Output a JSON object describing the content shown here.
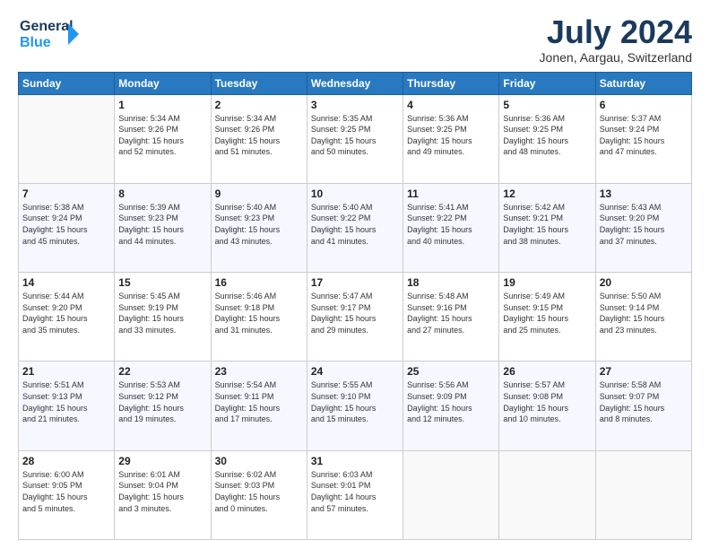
{
  "header": {
    "logo_line1": "General",
    "logo_line2": "Blue",
    "month_title": "July 2024",
    "subtitle": "Jonen, Aargau, Switzerland"
  },
  "days_of_week": [
    "Sunday",
    "Monday",
    "Tuesday",
    "Wednesday",
    "Thursday",
    "Friday",
    "Saturday"
  ],
  "weeks": [
    [
      {
        "day": "",
        "text": ""
      },
      {
        "day": "1",
        "text": "Sunrise: 5:34 AM\nSunset: 9:26 PM\nDaylight: 15 hours\nand 52 minutes."
      },
      {
        "day": "2",
        "text": "Sunrise: 5:34 AM\nSunset: 9:26 PM\nDaylight: 15 hours\nand 51 minutes."
      },
      {
        "day": "3",
        "text": "Sunrise: 5:35 AM\nSunset: 9:25 PM\nDaylight: 15 hours\nand 50 minutes."
      },
      {
        "day": "4",
        "text": "Sunrise: 5:36 AM\nSunset: 9:25 PM\nDaylight: 15 hours\nand 49 minutes."
      },
      {
        "day": "5",
        "text": "Sunrise: 5:36 AM\nSunset: 9:25 PM\nDaylight: 15 hours\nand 48 minutes."
      },
      {
        "day": "6",
        "text": "Sunrise: 5:37 AM\nSunset: 9:24 PM\nDaylight: 15 hours\nand 47 minutes."
      }
    ],
    [
      {
        "day": "7",
        "text": "Sunrise: 5:38 AM\nSunset: 9:24 PM\nDaylight: 15 hours\nand 45 minutes."
      },
      {
        "day": "8",
        "text": "Sunrise: 5:39 AM\nSunset: 9:23 PM\nDaylight: 15 hours\nand 44 minutes."
      },
      {
        "day": "9",
        "text": "Sunrise: 5:40 AM\nSunset: 9:23 PM\nDaylight: 15 hours\nand 43 minutes."
      },
      {
        "day": "10",
        "text": "Sunrise: 5:40 AM\nSunset: 9:22 PM\nDaylight: 15 hours\nand 41 minutes."
      },
      {
        "day": "11",
        "text": "Sunrise: 5:41 AM\nSunset: 9:22 PM\nDaylight: 15 hours\nand 40 minutes."
      },
      {
        "day": "12",
        "text": "Sunrise: 5:42 AM\nSunset: 9:21 PM\nDaylight: 15 hours\nand 38 minutes."
      },
      {
        "day": "13",
        "text": "Sunrise: 5:43 AM\nSunset: 9:20 PM\nDaylight: 15 hours\nand 37 minutes."
      }
    ],
    [
      {
        "day": "14",
        "text": "Sunrise: 5:44 AM\nSunset: 9:20 PM\nDaylight: 15 hours\nand 35 minutes."
      },
      {
        "day": "15",
        "text": "Sunrise: 5:45 AM\nSunset: 9:19 PM\nDaylight: 15 hours\nand 33 minutes."
      },
      {
        "day": "16",
        "text": "Sunrise: 5:46 AM\nSunset: 9:18 PM\nDaylight: 15 hours\nand 31 minutes."
      },
      {
        "day": "17",
        "text": "Sunrise: 5:47 AM\nSunset: 9:17 PM\nDaylight: 15 hours\nand 29 minutes."
      },
      {
        "day": "18",
        "text": "Sunrise: 5:48 AM\nSunset: 9:16 PM\nDaylight: 15 hours\nand 27 minutes."
      },
      {
        "day": "19",
        "text": "Sunrise: 5:49 AM\nSunset: 9:15 PM\nDaylight: 15 hours\nand 25 minutes."
      },
      {
        "day": "20",
        "text": "Sunrise: 5:50 AM\nSunset: 9:14 PM\nDaylight: 15 hours\nand 23 minutes."
      }
    ],
    [
      {
        "day": "21",
        "text": "Sunrise: 5:51 AM\nSunset: 9:13 PM\nDaylight: 15 hours\nand 21 minutes."
      },
      {
        "day": "22",
        "text": "Sunrise: 5:53 AM\nSunset: 9:12 PM\nDaylight: 15 hours\nand 19 minutes."
      },
      {
        "day": "23",
        "text": "Sunrise: 5:54 AM\nSunset: 9:11 PM\nDaylight: 15 hours\nand 17 minutes."
      },
      {
        "day": "24",
        "text": "Sunrise: 5:55 AM\nSunset: 9:10 PM\nDaylight: 15 hours\nand 15 minutes."
      },
      {
        "day": "25",
        "text": "Sunrise: 5:56 AM\nSunset: 9:09 PM\nDaylight: 15 hours\nand 12 minutes."
      },
      {
        "day": "26",
        "text": "Sunrise: 5:57 AM\nSunset: 9:08 PM\nDaylight: 15 hours\nand 10 minutes."
      },
      {
        "day": "27",
        "text": "Sunrise: 5:58 AM\nSunset: 9:07 PM\nDaylight: 15 hours\nand 8 minutes."
      }
    ],
    [
      {
        "day": "28",
        "text": "Sunrise: 6:00 AM\nSunset: 9:05 PM\nDaylight: 15 hours\nand 5 minutes."
      },
      {
        "day": "29",
        "text": "Sunrise: 6:01 AM\nSunset: 9:04 PM\nDaylight: 15 hours\nand 3 minutes."
      },
      {
        "day": "30",
        "text": "Sunrise: 6:02 AM\nSunset: 9:03 PM\nDaylight: 15 hours\nand 0 minutes."
      },
      {
        "day": "31",
        "text": "Sunrise: 6:03 AM\nSunset: 9:01 PM\nDaylight: 14 hours\nand 57 minutes."
      },
      {
        "day": "",
        "text": ""
      },
      {
        "day": "",
        "text": ""
      },
      {
        "day": "",
        "text": ""
      }
    ]
  ]
}
